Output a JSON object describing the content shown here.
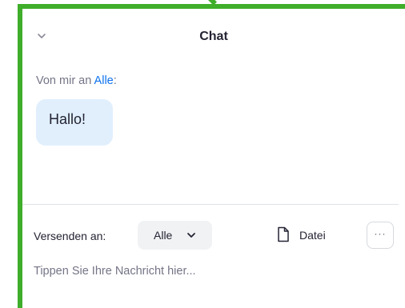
{
  "chat": {
    "title": "Chat"
  },
  "message": {
    "sender_prefix": "Von mir an ",
    "recipient": "Alle",
    "sender_suffix": ":",
    "text": "Hallo!"
  },
  "composer": {
    "send_to_label": "Versenden an:",
    "recipient_value": "Alle",
    "file_label": "Datei",
    "more_label": "···",
    "input_placeholder": "Tippen Sie Ihre Nachricht hier..."
  },
  "colors": {
    "annotation_frame": "#3fae2a",
    "link_blue": "#0e72ed",
    "bubble_bg": "#e1effd"
  },
  "icons": {
    "collapse": "chevron-down-icon",
    "recipient_dropdown": "chevron-down-icon",
    "file": "file-icon",
    "more": "more-icon"
  }
}
